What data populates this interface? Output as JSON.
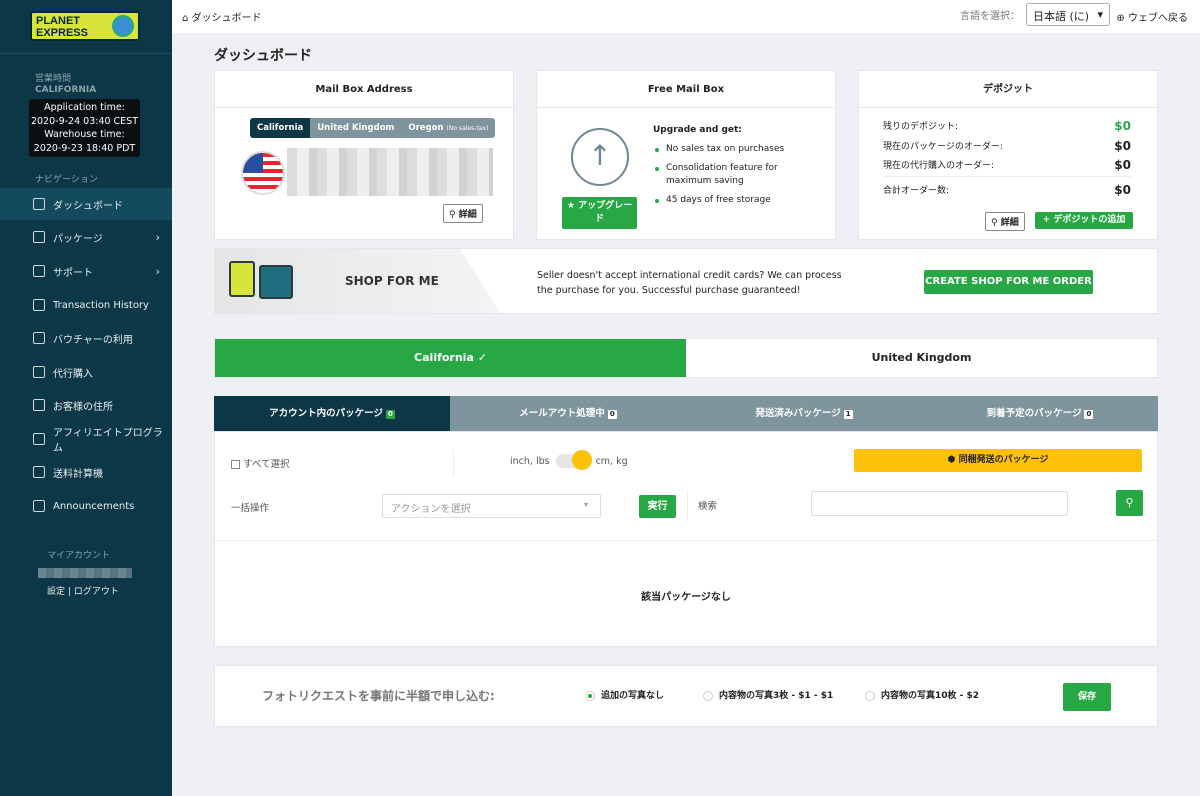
{
  "sidebar": {
    "logo_line1": "PLANET",
    "logo_line2": "EXPRESS",
    "hours_label": "営業時間",
    "hours_location": "CALIFORNIA",
    "tooltip": {
      "app_label": "Application time:",
      "app_time": "2020-9-24 03:40 CEST",
      "wh_label": "Warehouse time:",
      "wh_time": "2020-9-23 18:40 PDT"
    },
    "nav_heading": "ナビゲーション",
    "items": [
      {
        "label": "ダッシュボード",
        "icon": "dashboard-icon"
      },
      {
        "label": "パッケージ",
        "icon": "package-icon"
      },
      {
        "label": "サポート",
        "icon": "support-icon"
      },
      {
        "label": "Transaction History",
        "icon": "history-icon"
      },
      {
        "label": "バウチャーの利用",
        "icon": "voucher-icon"
      },
      {
        "label": "代行購入",
        "icon": "shopping-bag-icon"
      },
      {
        "label": "お客様の住所",
        "icon": "location-icon"
      },
      {
        "label": "アフィリエイトプログラム",
        "icon": "affiliate-icon"
      },
      {
        "label": "送料計算機",
        "icon": "calculator-icon"
      },
      {
        "label": "Announcements",
        "icon": "mail-icon"
      }
    ],
    "account_heading": "マイアカウント",
    "settings": "設定",
    "separator": "|",
    "logout": "ログアウト"
  },
  "topbar": {
    "breadcrumb": "ダッシュボード",
    "lang_label": "言語を選択：",
    "lang_value": "日本語 (に)",
    "back_label": "ウェブへ戻る"
  },
  "page_title": "ダッシュボード",
  "mailbox": {
    "title": "Mail Box Address",
    "tabs": [
      "California",
      "United Kingdom",
      "Oregon"
    ],
    "oregon_note": "(No sales-tax)",
    "detail": "詳細"
  },
  "free": {
    "title": "Free Mail Box",
    "upgrade_btn": "アップグレード",
    "heading": "Upgrade and get:",
    "benefits": [
      "No sales tax on purchases",
      "Consolidation feature for maximum saving",
      "45 days of free storage"
    ]
  },
  "deposit": {
    "title": "デポジット",
    "rows": [
      {
        "label": "残りのデポジット:",
        "value": "$0"
      },
      {
        "label": "現在のパッケージのオーダー:",
        "value": "$0"
      },
      {
        "label": "現在の代行購入のオーダー:",
        "value": "$0"
      },
      {
        "label": "合計オーダー数:",
        "value": "$0"
      }
    ],
    "detail": "詳細",
    "add": "デポジットの追加",
    "accent": "#28a745"
  },
  "shop": {
    "title": "SHOP FOR ME",
    "text1": "Seller doesn't accept international credit cards? We can process",
    "text2": "the purchase for you. Successful purchase guaranteed!",
    "cta": "CREATE SHOP FOR ME ORDER"
  },
  "locations": [
    {
      "label": "California",
      "selected": true
    },
    {
      "label": "United Kingdom",
      "selected": false
    }
  ],
  "package_tabs": [
    {
      "label": "アカウント内のパッケージ",
      "count": "0"
    },
    {
      "label": "メールアウト処理中",
      "count": "0"
    },
    {
      "label": "発送済みパッケージ",
      "count": "1"
    },
    {
      "label": "到着予定のパッケージ",
      "count": "0"
    }
  ],
  "panel": {
    "select_all": "すべて選択",
    "unit_left": "inch, lbs",
    "unit_right": "cm, kg",
    "unit_metric": true,
    "consolidate": "同梱発送のパッケージ",
    "bulk_label": "一括操作",
    "action_placeholder": "アクションを選択",
    "run": "実行",
    "search_label": "検索",
    "search_value": "",
    "empty": "該当パッケージなし"
  },
  "photo": {
    "label": "フォトリクエストを事前に半額で申し込む:",
    "options": [
      {
        "label": "追加の写真なし",
        "selected": true
      },
      {
        "label": "内容物の写真3枚 - $1 - $1",
        "selected": false
      },
      {
        "label": "内容物の写真10枚 - $2",
        "selected": false
      }
    ],
    "save": "保存"
  },
  "colors": {
    "sidebar": "#0c3746",
    "green": "#28a745",
    "yellow": "#ffc107",
    "tab_gray": "#7f959d"
  }
}
